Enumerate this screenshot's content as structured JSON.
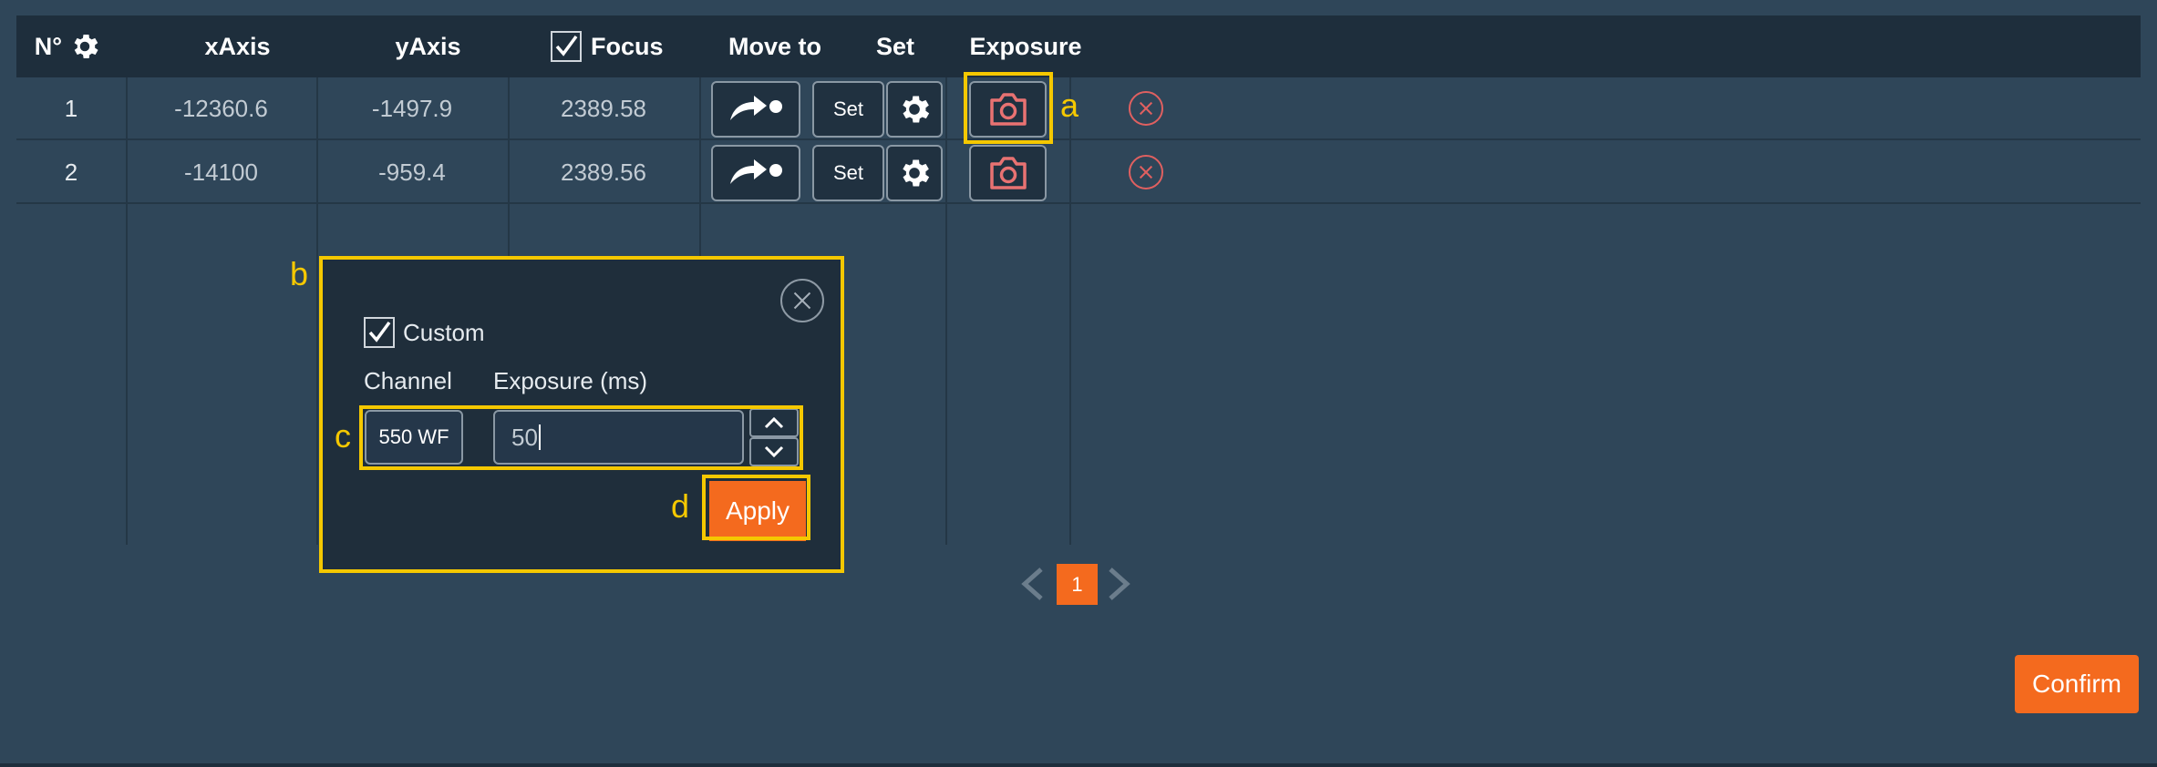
{
  "table": {
    "headers": {
      "number": "N°",
      "xaxis": "xAxis",
      "yaxis": "yAxis",
      "focus": "Focus",
      "move_to": "Move to",
      "set": "Set",
      "exposure": "Exposure"
    },
    "focus_checked": true,
    "rows": [
      {
        "num": "1",
        "x": "-12360.6",
        "y": "-1497.9",
        "focus": "2389.58",
        "set_label": "Set"
      },
      {
        "num": "2",
        "x": "-14100",
        "y": "-959.4",
        "focus": "2389.56",
        "set_label": "Set"
      }
    ]
  },
  "popup": {
    "custom_label": "Custom",
    "custom_checked": true,
    "channel_label": "Channel",
    "exposure_label": "Exposure (ms)",
    "channel_value": "550 WF",
    "exposure_value": "50",
    "apply_label": "Apply"
  },
  "annotations": {
    "a": "a",
    "b": "b",
    "c": "c",
    "d": "d"
  },
  "pagination": {
    "current_page": "1"
  },
  "confirm_label": "Confirm",
  "colors": {
    "accent": "#f46a1e",
    "annotation": "#f5c800",
    "danger": "#e06060",
    "camera": "#e87272"
  },
  "icons": [
    "gear-icon",
    "checkbox-icon",
    "arrow-move-icon",
    "camera-icon",
    "remove-icon",
    "close-icon",
    "chevron-up-icon",
    "chevron-down-icon",
    "chevron-left-icon",
    "chevron-right-icon"
  ]
}
